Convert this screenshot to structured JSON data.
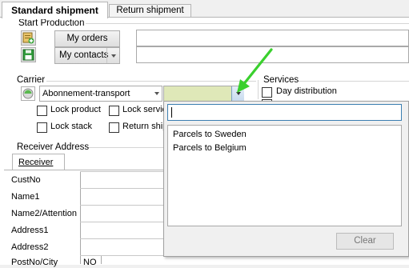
{
  "tabs": [
    {
      "label": "Standard shipment",
      "active": true
    },
    {
      "label": "Return shipment",
      "active": false
    }
  ],
  "start_production": {
    "title": "Start Production",
    "my_orders_label": "My orders",
    "my_contacts_label": "My contacts"
  },
  "carrier": {
    "title": "Carrier",
    "selected": "Abonnement-transport",
    "product_value": "",
    "lock_product": "Lock product",
    "lock_service": "Lock servic",
    "lock_stack": "Lock stack",
    "return_shipment": "Return ship"
  },
  "services": {
    "title": "Services",
    "items": [
      "Day distribution"
    ]
  },
  "dropdown": {
    "search_value": "",
    "items": [
      "Parcels to Sweden",
      "Parcels to Belgium"
    ],
    "clear_label": "Clear"
  },
  "receiver": {
    "title": "Receiver Address",
    "tab_label": "Receiver",
    "fields": [
      "CustNo",
      "Name1",
      "Name2/Attention",
      "Address1",
      "Address2",
      "PostNo/City"
    ],
    "country_code": "NO"
  },
  "colors": {
    "tab_border": "#b5b5b5",
    "highlight_field": "#dfe8b8",
    "focus_border": "#3c7fb1",
    "arrow_green": "#3ad02e"
  }
}
